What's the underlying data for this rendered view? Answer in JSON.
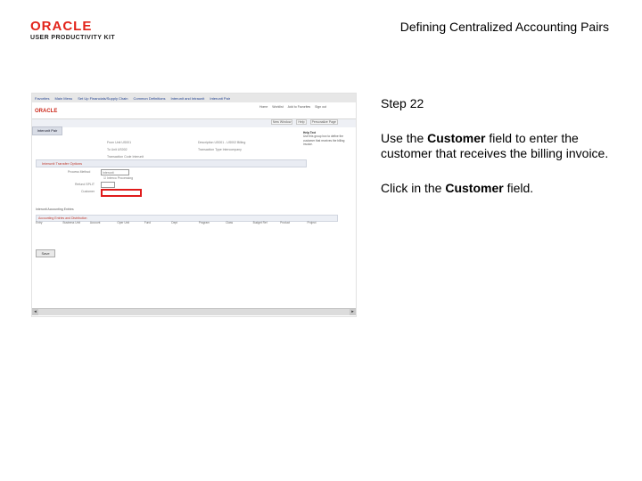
{
  "logo": {
    "brand": "ORACLE",
    "sub": "USER PRODUCTIVITY KIT"
  },
  "title": "Defining Centralized Accounting Pairs",
  "shot": {
    "nav_items": [
      "Favorites",
      "Main Menu",
      "Set Up Financials/Supply Chain",
      "Common Definitions",
      "Interunit and Intraunit",
      "Interunit Pair"
    ],
    "logo": "ORACLE",
    "top_links": [
      "Home",
      "Worklist",
      "Add to Favorites",
      "Sign out"
    ],
    "sub_links": [
      "New Window",
      "Help",
      "Personalize Page"
    ],
    "tab_label": "Interunit Pair",
    "help_title": "Help Text",
    "help_text": "Use this group box to define the customer that receives the billing invoice.",
    "fields": [
      {
        "label": "From Unit",
        "value": "US001"
      },
      {
        "label": "To Unit",
        "value": "US002"
      },
      {
        "label": "Transaction Code",
        "value": "Interunit"
      },
      {
        "label": "Description",
        "value": "US001 - US002 Billing"
      },
      {
        "label": "Transaction Type",
        "value": "Intercompany"
      }
    ],
    "section_title": "Interunit Transfer Options",
    "process_label": "Process Method",
    "process_value": "Interunit",
    "checkbox_label": "Interco Processing",
    "refund_label": "Refund SPLIT",
    "customer_label": "Customer",
    "grid_title": "Interunit Accounting Entries",
    "grid_header": "Accounting Entries and Distribution",
    "grid_columns": [
      "Entry",
      "Business Unit",
      "Account",
      "Oper Unit",
      "Fund",
      "Dept",
      "Program",
      "Class",
      "Budget Ref",
      "Product",
      "Project"
    ],
    "save_label": "Save"
  },
  "step": "Step 22",
  "instruction": {
    "pre": "Use the ",
    "bold": "Customer",
    "post": " field to enter the customer that receives the billing invoice."
  },
  "action": {
    "pre": "Click in the ",
    "bold": "Customer",
    "post": " field."
  }
}
